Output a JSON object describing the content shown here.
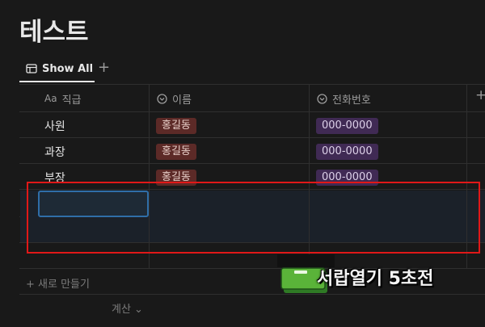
{
  "page": {
    "title": "테스트"
  },
  "views": {
    "active_tab": "Show All",
    "add_view": "+"
  },
  "table": {
    "columns": [
      {
        "icon": "text-type-icon",
        "icon_text": "Aa",
        "label": "직급"
      },
      {
        "icon": "select-icon",
        "label": "이름"
      },
      {
        "icon": "select-icon",
        "label": "전화번호"
      }
    ],
    "add_column": "+",
    "rows": [
      {
        "position": "사원",
        "name": "홍길동",
        "phone": "000-0000"
      },
      {
        "position": "과장",
        "name": "홍길동",
        "phone": "000-0000"
      },
      {
        "position": "부장",
        "name": "홍길동",
        "phone": "000-0000"
      }
    ],
    "new_row_label": "+ 새로 만들기",
    "calculate_label": "계산 ⌄"
  },
  "overlay": {
    "caption": "서랍열기 5초전"
  },
  "colors": {
    "name_tag_bg": "#5c2a27",
    "phone_tag_bg": "#402a54",
    "highlight_border": "#e01818",
    "selection_border": "#2f6ea8"
  }
}
